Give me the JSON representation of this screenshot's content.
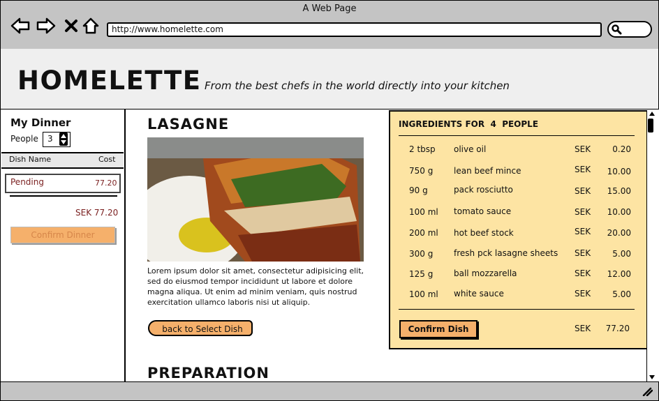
{
  "window": {
    "title": "A Web Page",
    "url": "http://www.homelette.com"
  },
  "header": {
    "site_title": "HOMELETTE",
    "tagline": "From the best chefs in the world directly into your kitchen"
  },
  "sidebar": {
    "title": "My Dinner",
    "people_label": "People",
    "people_value": "3",
    "table_headers": {
      "name": "Dish Name",
      "cost": "Cost"
    },
    "rows": [
      {
        "name": "Pending",
        "cost": "77.20"
      }
    ],
    "total": "SEK 77.20",
    "confirm_label": "Confirm Dinner"
  },
  "dish": {
    "title": "LASAGNE",
    "description": "Lorem ipsum dolor sit amet, consectetur adipisicing elit, sed do eiusmod tempor incididunt ut labore et dolore magna aliqua. Ut enim ad minim veniam, quis nostrud exercitation ullamco laboris nisi ut aliquip.",
    "back_label": "back to Select Dish",
    "preparation_title": "PREPARATION"
  },
  "ingredients": {
    "header_prefix": "INGREDIENTS FOR",
    "people_count": "4",
    "header_suffix": "PEOPLE",
    "items": [
      {
        "qty": "2 tbsp",
        "name": "olive oil",
        "currency": "SEK",
        "price": "0.20"
      },
      {
        "qty": "750 g",
        "name": "lean beef mince",
        "currency": "SEK",
        "price": "10.00"
      },
      {
        "qty": "90 g",
        "name": "pack rosciutto",
        "currency": "SEK",
        "price": "15.00"
      },
      {
        "qty": "100 ml",
        "name": "tomato sauce",
        "currency": "SEK",
        "price": "10.00"
      },
      {
        "qty": "200 ml",
        "name": "hot beef stock",
        "currency": "SEK",
        "price": "20.00"
      },
      {
        "qty": "300 g",
        "name": "fresh pck lasagne sheets",
        "currency": "SEK",
        "price": "5.00"
      },
      {
        "qty": "125 g",
        "name": "ball mozzarella",
        "currency": "SEK",
        "price": "12.00"
      },
      {
        "qty": "100 ml",
        "name": "white sauce",
        "currency": "SEK",
        "price": "5.00"
      }
    ],
    "confirm_label": "Confirm Dish",
    "total_currency": "SEK",
    "total_value": "77.20"
  },
  "icons": [
    "back-arrow-icon",
    "forward-arrow-icon",
    "close-icon",
    "home-icon",
    "search-icon",
    "resize-grip-icon"
  ],
  "colors": {
    "accent": "#f5b06b",
    "panel": "#fde4a3",
    "chrome": "#c4c4c4",
    "header_bg": "#efefef"
  }
}
